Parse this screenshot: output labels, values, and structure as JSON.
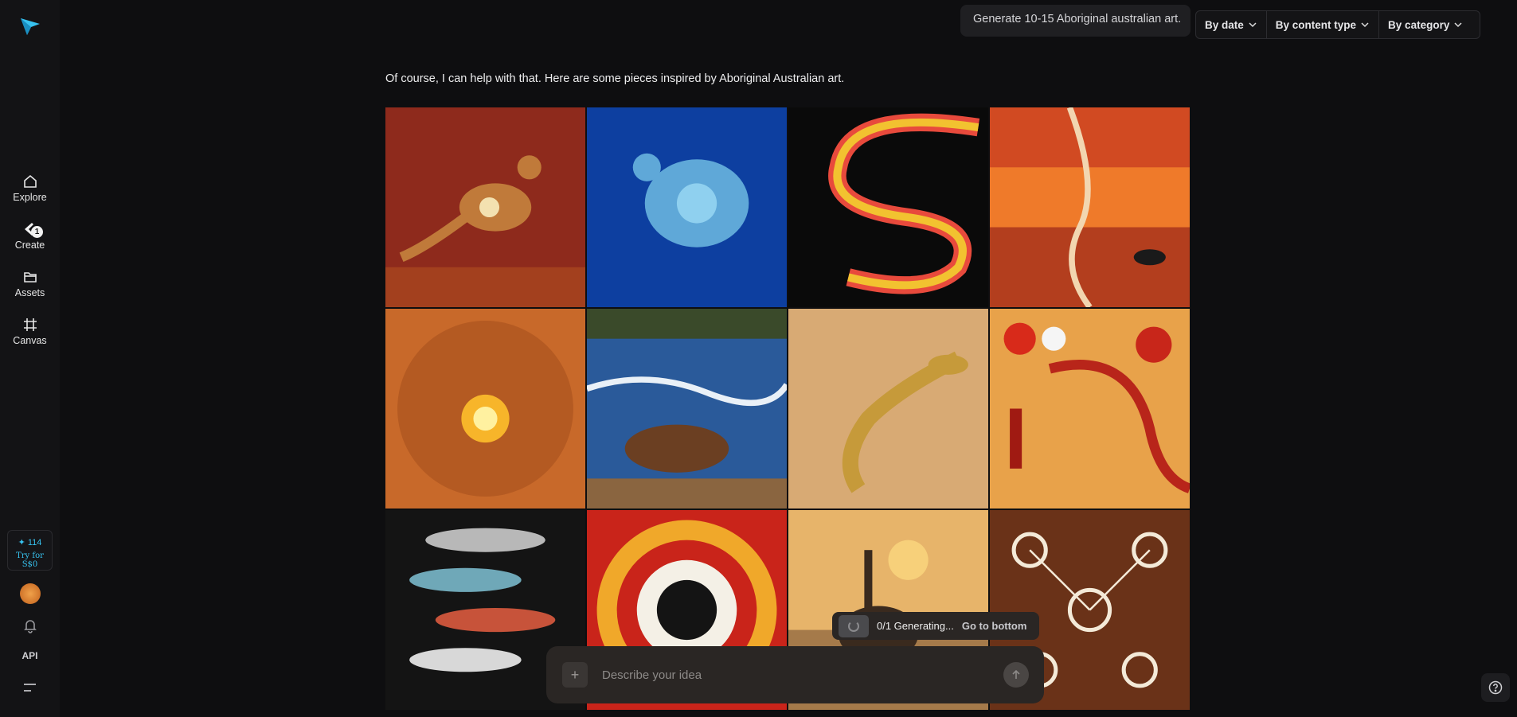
{
  "sidebar": {
    "items": [
      {
        "label": "Explore",
        "icon": "home-icon"
      },
      {
        "label": "Create",
        "icon": "create-icon",
        "badge": "1"
      },
      {
        "label": "Assets",
        "icon": "folder-icon"
      },
      {
        "label": "Canvas",
        "icon": "canvas-icon"
      }
    ],
    "credits_count": "✦ 114",
    "credits_cta": "Try for S$0",
    "api_label": "API"
  },
  "header": {
    "prompt": "Generate 10-15 Aboriginal australian art.",
    "filters": [
      "By date",
      "By content type",
      "By category"
    ]
  },
  "response_text": "Of course, I can help with that. Here are some pieces inspired by Aboriginal Australian art.",
  "images": [
    {
      "subject": "kangaroo"
    },
    {
      "subject": "sea turtle"
    },
    {
      "subject": "rainbow serpent"
    },
    {
      "subject": "desert landscape"
    },
    {
      "subject": "campfire gathering"
    },
    {
      "subject": "platypus"
    },
    {
      "subject": "goanna lizard"
    },
    {
      "subject": "emus and figures"
    },
    {
      "subject": "x-ray fish"
    },
    {
      "subject": "dot circles"
    },
    {
      "subject": "emu at sunset"
    },
    {
      "subject": "kangaroo dreaming"
    }
  ],
  "generation": {
    "status": "0/1 Generating...",
    "go_bottom": "Go to bottom"
  },
  "composer": {
    "placeholder": "Describe your idea"
  },
  "colors": {
    "accent": "#37c2ef",
    "background": "#0e0e10"
  }
}
